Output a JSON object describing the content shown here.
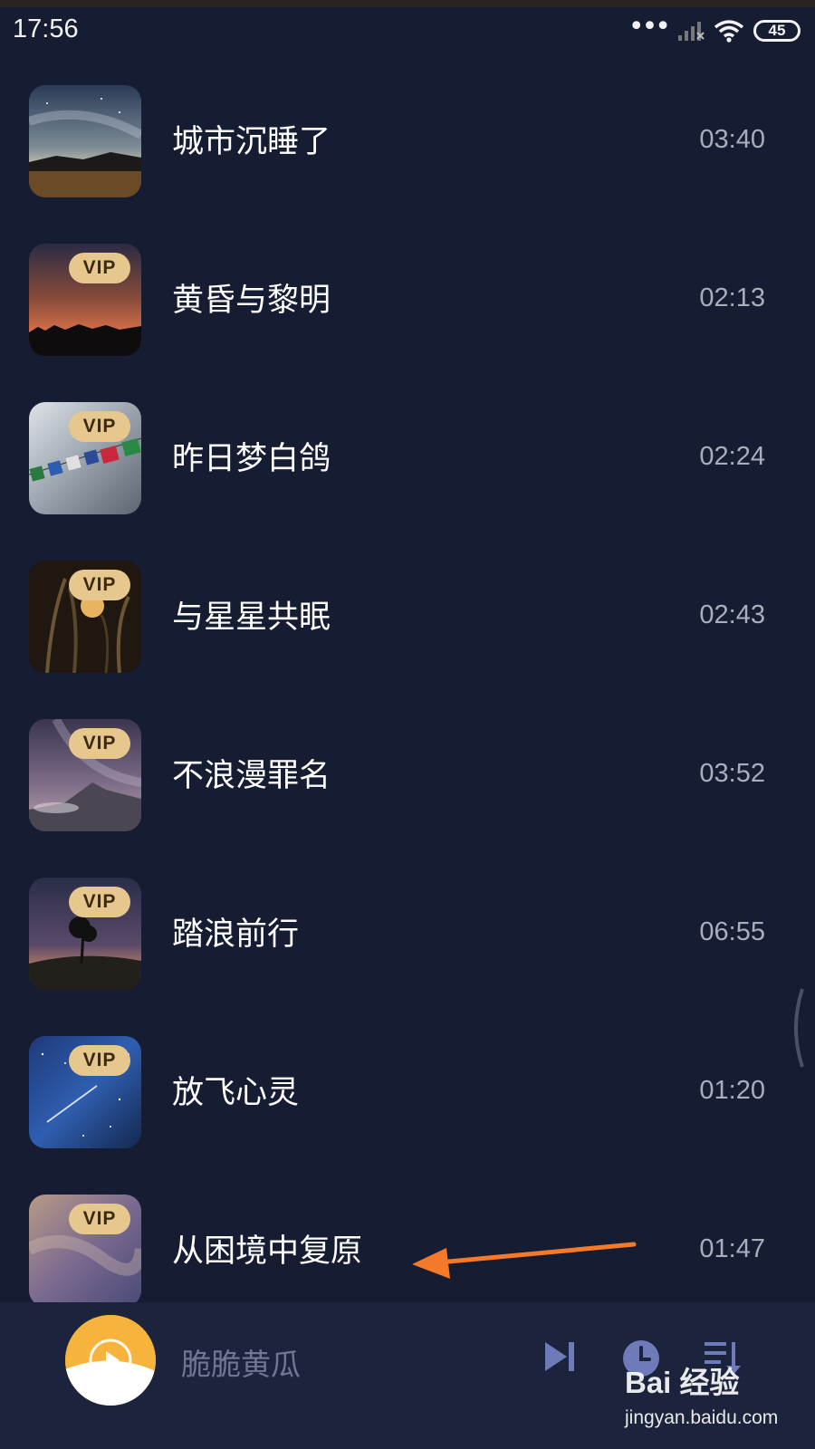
{
  "status_bar": {
    "time": "17:56",
    "battery": "45",
    "icons": [
      "more-dots-icon",
      "signal-icon",
      "wifi-icon",
      "battery-icon"
    ]
  },
  "tracks": [
    {
      "title": "城市沉睡了",
      "duration": "03:40",
      "vip": false
    },
    {
      "title": "黄昏与黎明",
      "duration": "02:13",
      "vip": true,
      "vip_label": "VIP"
    },
    {
      "title": "昨日梦白鸽",
      "duration": "02:24",
      "vip": true,
      "vip_label": "VIP"
    },
    {
      "title": "与星星共眠",
      "duration": "02:43",
      "vip": true,
      "vip_label": "VIP"
    },
    {
      "title": "不浪漫罪名",
      "duration": "03:52",
      "vip": true,
      "vip_label": "VIP"
    },
    {
      "title": "踏浪前行",
      "duration": "06:55",
      "vip": true,
      "vip_label": "VIP"
    },
    {
      "title": "放飞心灵",
      "duration": "01:20",
      "vip": true,
      "vip_label": "VIP"
    },
    {
      "title": "从困境中复原",
      "duration": "01:47",
      "vip": true,
      "vip_label": "VIP"
    }
  ],
  "player": {
    "now_playing": "脆脆黄瓜",
    "buttons": [
      "skip-next-icon",
      "timer-icon",
      "playlist-icon"
    ]
  },
  "watermark": {
    "brand": "Bai 经验",
    "url": "jingyan.baidu.com"
  },
  "colors": {
    "background": "#161c31",
    "player_bar": "#1c233c",
    "vip_badge": "#e6c88f",
    "arrow": "#f47a2a",
    "player_icons": "#6e7bb8"
  }
}
